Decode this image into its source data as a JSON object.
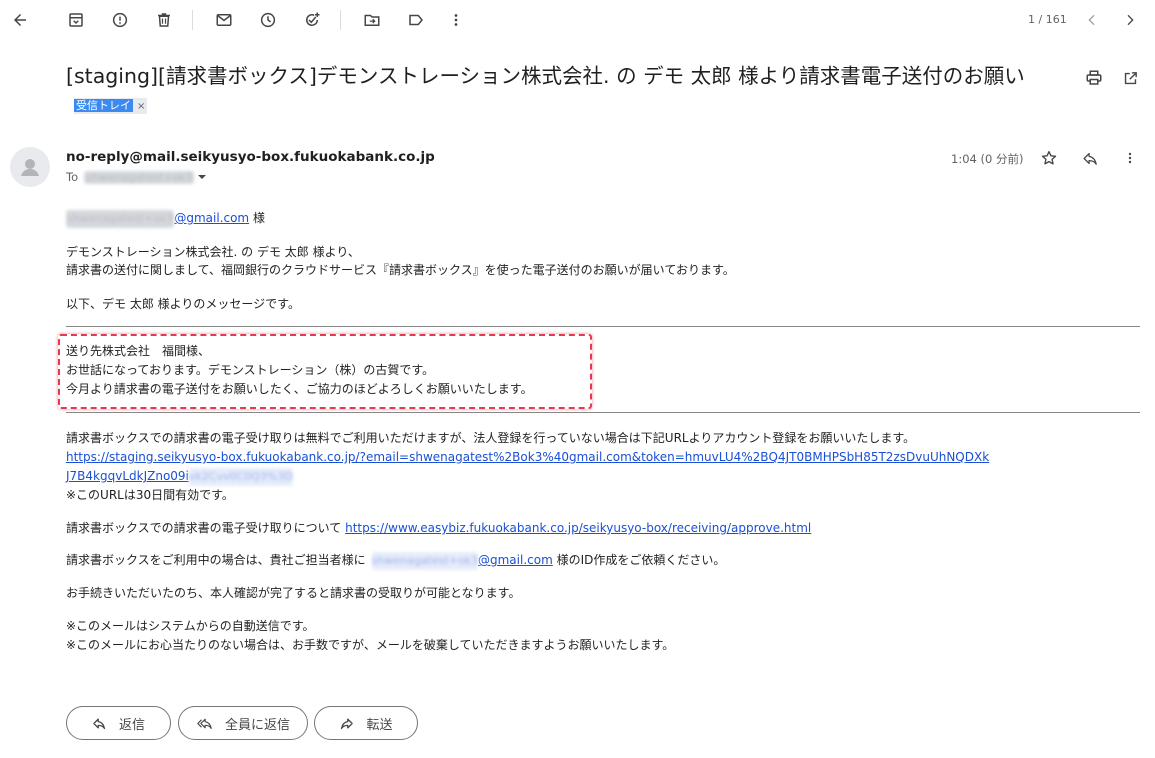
{
  "toolbar": {
    "icons": [
      "back-arrow-icon",
      "archive-icon",
      "report-spam-icon",
      "delete-icon",
      "mark-unread-icon",
      "snooze-icon",
      "add-task-icon",
      "move-to-icon",
      "label-icon",
      "more-vertical-icon"
    ],
    "count": "1 / 161"
  },
  "email": {
    "subject": "[staging][請求書ボックス]デモンストレーション株式会社. の デモ 太郎 様より請求書電子送付のお願い",
    "label": "受信トレイ",
    "label_close": "×",
    "sender": "no-reply@mail.seikyusyo-box.fukuokabank.co.jp",
    "to_prefix": "To",
    "to_blurred": "shwenagatest+ok3",
    "time": "1:04 (0 分前)"
  },
  "body": {
    "greeting_blurred": "shwenagatest+ok3",
    "greeting_link": "@gmail.com",
    "greeting_suffix": " 様",
    "intro_line1": "デモンストレーション株式会社. の デモ 太郎 様より、",
    "intro_line2": "請求書の送付に関しまして、福岡銀行のクラウドサービス『請求書ボックス』を使った電子送付のお願いが届いております。",
    "message_intro": "以下、デモ 太郎 様よりのメッセージです。",
    "message_line1": "送り先株式会社　福間様、",
    "message_line2": "お世話になっております。デモンストレーション（株）の古賀です。",
    "message_line3": "今月より請求書の電子送付をお願いしたく、ご協力のほどよろしくお願いいたします。",
    "register_text": "請求書ボックスでの請求書の電子受け取りは無料でご利用いただけますが、法人登録を行っていない場合は下記URLよりアカウント登録をお願いいたします。",
    "register_link_line1": "https://staging.seikyusyo-box.fukuokabank.co.jp/?email=shwenagatest%2Bok3%40gmail.com&token=hmuvLU4%2BQ4JT0BMHPSbH85T2zsDvuUhNQDXk",
    "register_link_line2": "J7B4kgqvLdkJZno09i",
    "register_link_blurred": "vk2Cvv0C0Q3%3D",
    "url_validity": "※このURLは30日間有効です。",
    "receiving_text": "請求書ボックスでの請求書の電子受け取りについて ",
    "receiving_link": "https://www.easybiz.fukuokabank.co.jp/seikyusyo-box/receiving/approve.html",
    "inuse_prefix": "請求書ボックスをご利用中の場合は、貴社ご担当者様に",
    "inuse_blurred": "shwenagatest+ok3",
    "inuse_link": "@gmail.com",
    "inuse_suffix": " 様のID作成をご依頼ください。",
    "procedure": "お手続きいただいたのち、本人確認が完了すると請求書の受取りが可能となります。",
    "auto_note": "※このメールはシステムからの自動送信です。",
    "discard_note": "※このメールにお心当たりのない場合は、お手数ですが、メールを破棄していただきますようお願いいたします。"
  },
  "actions": {
    "reply": "返信",
    "reply_all": "全員に返信",
    "forward": "転送"
  }
}
